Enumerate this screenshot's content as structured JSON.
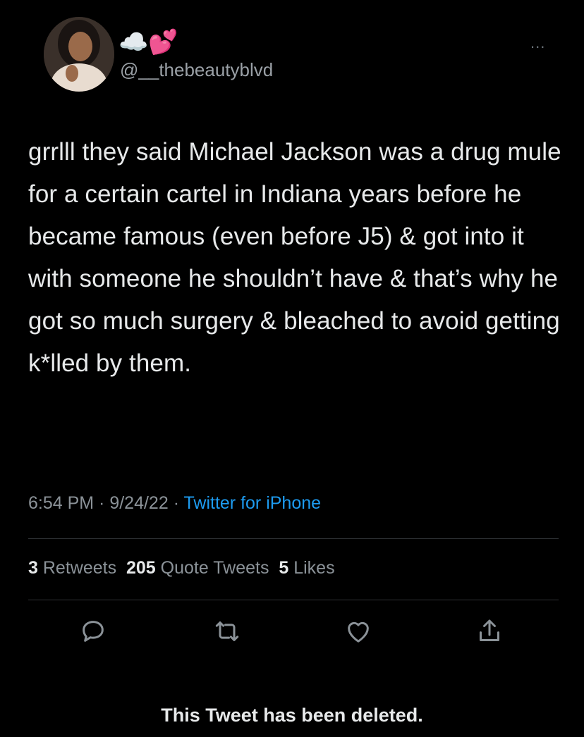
{
  "user": {
    "display_name": "☁️💕",
    "handle": "@__thebeautyblvd"
  },
  "more_menu": "...",
  "tweet": {
    "text": "grrlll they said Michael Jackson was a drug mule for a certain cartel in Indiana years before he became famous (even before J5)  & got into it with someone he shouldn’t have & that’s why he got so much surgery & bleached to avoid getting k*lled by them."
  },
  "meta": {
    "time": "6:54 PM",
    "sep1": " · ",
    "date": "9/24/22",
    "sep2": " · ",
    "source": "Twitter for iPhone"
  },
  "stats": {
    "retweets_count": "3",
    "retweets_label": "Retweets",
    "quotes_count": "205",
    "quotes_label": "Quote Tweets",
    "likes_count": "5",
    "likes_label": "Likes"
  },
  "actions": {
    "icons": [
      "reply-icon",
      "retweet-icon",
      "like-icon",
      "share-icon"
    ]
  },
  "footer": {
    "deleted_notice": "This Tweet has been deleted."
  },
  "colors": {
    "background": "#000000",
    "text": "#e7e9ea",
    "secondary": "#8b9298",
    "link": "#1d9bf0",
    "divider": "#2f3336"
  }
}
